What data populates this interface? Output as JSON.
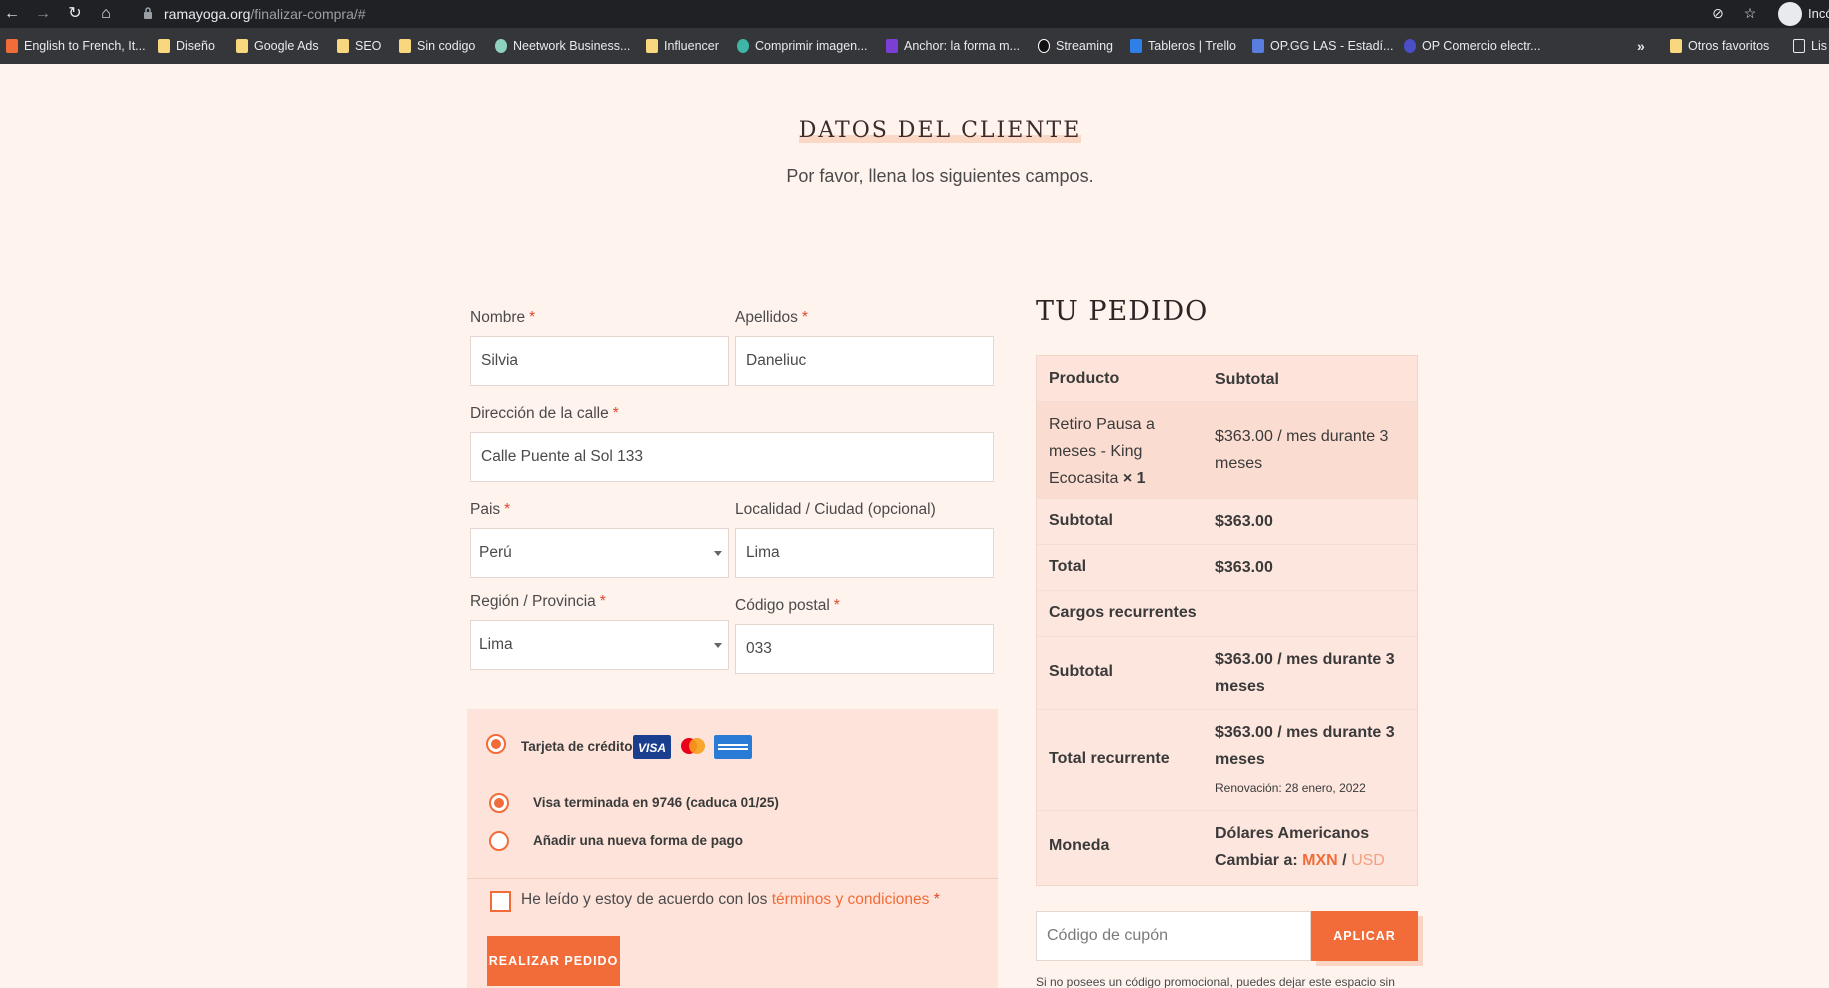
{
  "browser": {
    "url_domain": "ramayoga.org",
    "url_path": "/finalizar-compra/#",
    "profile_label": "Incó",
    "bookmarks": [
      "English to French, It...",
      "Diseño",
      "Google Ads",
      "SEO",
      "Sin codigo",
      "Neetwork Business...",
      "Influencer",
      "Comprimir imagen...",
      "Anchor: la forma m...",
      "Streaming",
      "Tableros | Trello",
      "OP.GG LAS - Estadí...",
      "OP Comercio electr..."
    ],
    "more": "»",
    "other_favorites": "Otros favoritos",
    "reading_list": "Lis"
  },
  "header": {
    "title": "DATOS DEL CLIENTE",
    "subtitle": "Por favor, llena los siguientes campos."
  },
  "form": {
    "nombre_label": "Nombre",
    "nombre_value": "Silvia",
    "apellidos_label": "Apellidos",
    "apellidos_value": "Daneliuc",
    "direccion_label": "Dirección de la calle",
    "direccion_value": "Calle Puente al Sol 133",
    "pais_label": "Pais",
    "pais_value": "Perú",
    "localidad_label": "Localidad / Ciudad (opcional)",
    "localidad_value": "Lima",
    "region_label": "Región / Provincia",
    "region_value": "Lima",
    "postal_label": "Código postal",
    "postal_value": "033",
    "required_mark": "*"
  },
  "payment": {
    "method_label": "Tarjeta de crédito",
    "saved_card": "Visa terminada en 9746 (caduca 01/25)",
    "new_method": "Añadir una nueva forma de pago",
    "card_visa": "VISA",
    "terms_prefix": "He leído y estoy de acuerdo con los ",
    "terms_link": "términos y condiciones",
    "terms_suffix": " *",
    "submit": "REALIZAR PEDIDO"
  },
  "order": {
    "title": "TU PEDIDO",
    "col_product": "Producto",
    "col_subtotal": "Subtotal",
    "product_name": "Retiro Pausa a meses - King Ecocasita",
    "product_qty": "× 1",
    "product_price": "$363.00 / mes durante 3 meses",
    "subtotal_label": "Subtotal",
    "subtotal_value": "$363.00",
    "total_label": "Total",
    "total_value": "$363.00",
    "recurring_label": "Cargos recurrentes",
    "rec_subtotal_label": "Subtotal",
    "rec_subtotal_value": "$363.00 / mes durante 3 meses",
    "rec_total_label": "Total recurrente",
    "rec_total_value": "$363.00 / mes durante 3 meses",
    "renewal": "Renovación: 28 enero, 2022",
    "currency_label": "Moneda",
    "currency_value": "Dólares Americanos",
    "change_label": "Cambiar a:",
    "currency_mxn": "MXN",
    "currency_sep": "/",
    "currency_usd": "USD"
  },
  "coupon": {
    "placeholder": "Código de cupón",
    "apply": "APLICAR",
    "note": "Si no posees un código promocional, puedes dejar este espacio sin"
  },
  "colors": {
    "accent": "#f26c3a",
    "page_bg": "#fff3ee",
    "panel_bg": "#fde6de"
  }
}
